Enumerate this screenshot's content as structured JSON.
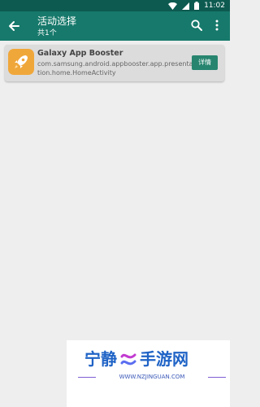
{
  "status_bar": {
    "time": "11:02"
  },
  "appbar": {
    "title": "活动选择",
    "subtitle": "共1个"
  },
  "activity": {
    "app_name": "Galaxy App Booster",
    "package": "com.samsung.android.appbooster.app.presentation.home.HomeActivity",
    "detail_label": "详情"
  },
  "watermark": {
    "left_text": "宁静",
    "right_text": "手游网",
    "url": "WWW.NZJINGUAN.COM"
  },
  "colors": {
    "status_bar": "#0d5a50",
    "app_bar": "#16796b",
    "accent_button": "#27856f",
    "app_icon": "#f0a73a",
    "watermark_text": "#1f63c6"
  }
}
